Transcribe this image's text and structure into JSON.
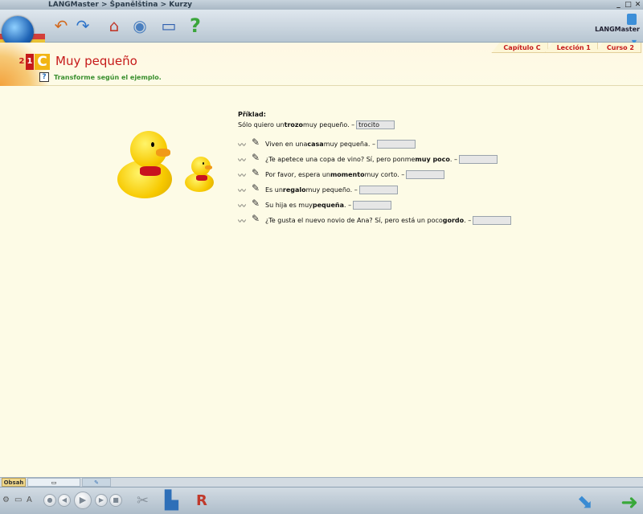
{
  "window": {
    "breadcrumb": "LANGMaster > Španělština > Kurzy"
  },
  "toolbar": {
    "brand": "LANGMaster",
    "buttons": [
      "back",
      "forward",
      "home",
      "course-disc",
      "dictionary",
      "help"
    ]
  },
  "lesson": {
    "badge_level": "2",
    "badge_sub": "1",
    "badge_letter": "C",
    "title": "Muy pequeño",
    "instruction": "Transforme según el ejemplo.",
    "crumbs": [
      "Capítulo C",
      "Lección 1",
      "Curso 2"
    ]
  },
  "exercise": {
    "example_label": "Příklad:",
    "example_prefix": "Sólo quiero un ",
    "example_bold": "trozo",
    "example_suffix": " muy pequeño. –",
    "example_answer": "trocito",
    "items": [
      {
        "a": "Viven en una ",
        "b": "casa",
        "c": " muy pequeña. –"
      },
      {
        "a": "¿Te apetece una copa de vino? Sí, pero ponme ",
        "b": "muy poco",
        "c": ". –"
      },
      {
        "a": "Por favor, espera un ",
        "b": "momento",
        "c": " muy corto. –"
      },
      {
        "a": "Es un ",
        "b": "regalo",
        "c": " muy pequeño. –"
      },
      {
        "a": "Su hija es muy ",
        "b": "pequeña",
        "c": ". –"
      },
      {
        "a": "¿Te gusta el nuevo novio de Ana? Sí, pero está un poco ",
        "b": "gordo",
        "c": ". –"
      }
    ]
  },
  "bottom": {
    "tab_obsah": "Obsah"
  }
}
